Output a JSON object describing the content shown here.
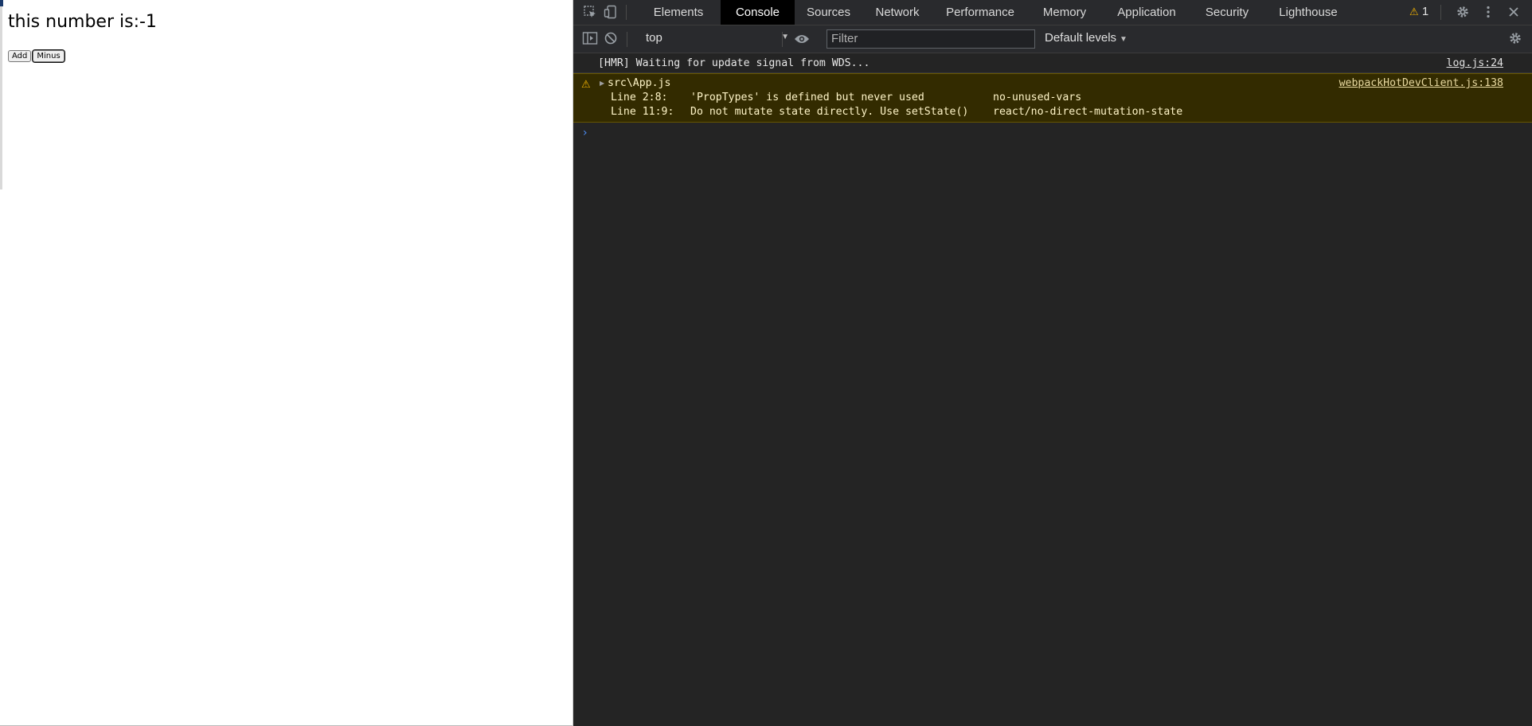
{
  "page": {
    "heading": "this number is:-1",
    "buttons": {
      "add": "Add",
      "minus": "Minus"
    }
  },
  "devtools": {
    "tabs": [
      {
        "label": "Elements"
      },
      {
        "label": "Console",
        "active": true
      },
      {
        "label": "Sources"
      },
      {
        "label": "Network"
      },
      {
        "label": "Performance"
      },
      {
        "label": "Memory"
      },
      {
        "label": "Application"
      },
      {
        "label": "Security"
      },
      {
        "label": "Lighthouse"
      }
    ],
    "warning_count": "1",
    "toolbar": {
      "context": "top",
      "filter_placeholder": "Filter",
      "levels": "Default levels"
    },
    "console": {
      "messages": [
        {
          "type": "info",
          "text": "[HMR] Waiting for update signal from WDS...",
          "source": "log.js:24"
        },
        {
          "type": "warning",
          "title": "src\\App.js",
          "source": "webpackHotDevClient.js:138",
          "lines": [
            {
              "loc": "Line 2:8:",
              "message": "'PropTypes' is defined but never used",
              "rule": "no-unused-vars"
            },
            {
              "loc": "Line 11:9:",
              "message": "Do not mutate state directly. Use setState()",
              "rule": "react/no-direct-mutation-state"
            }
          ]
        }
      ]
    },
    "colors": {
      "background": "#242424",
      "warning_bg": "#332b00",
      "warning_icon": "#f4b400",
      "prompt": "#4c8df6"
    }
  }
}
